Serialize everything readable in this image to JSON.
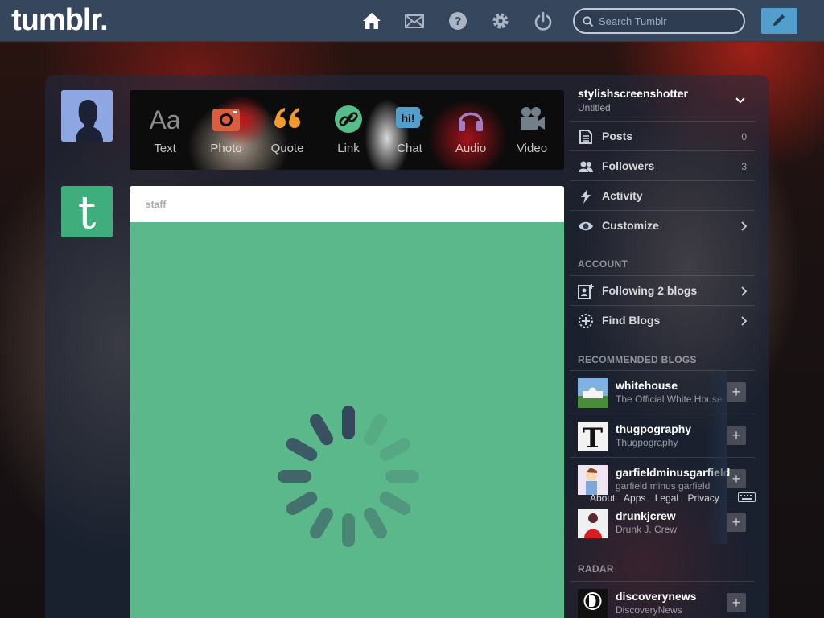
{
  "topbar": {
    "logo": "tumblr.",
    "icons": [
      "home-icon",
      "mail-icon",
      "help-icon",
      "settings-icon",
      "power-icon"
    ],
    "search_placeholder": "Search Tumblr",
    "accent": "#36465d",
    "compose_color": "#529ecc"
  },
  "post_types": [
    {
      "label": "Text",
      "icon": "text-icon",
      "color": "#8c8c8c"
    },
    {
      "label": "Photo",
      "icon": "camera-icon",
      "color": "#d95e40"
    },
    {
      "label": "Quote",
      "icon": "quote-icon",
      "color": "#f2992e"
    },
    {
      "label": "Link",
      "icon": "link-icon",
      "color": "#56bc8a"
    },
    {
      "label": "Chat",
      "icon": "chat-icon",
      "color": "#529ecc"
    },
    {
      "label": "Audio",
      "icon": "headphones-icon",
      "color": "#a77dc2"
    },
    {
      "label": "Video",
      "icon": "video-camera-icon",
      "color": "#748089"
    }
  ],
  "post": {
    "author": "staff",
    "body_color": "#5ab88a"
  },
  "sidebar": {
    "blog_name": "stylishscreenshotter",
    "blog_title": "Untitled",
    "stats": [
      {
        "label": "Posts",
        "count": "0",
        "icon": "posts-icon"
      },
      {
        "label": "Followers",
        "count": "3",
        "icon": "followers-icon"
      },
      {
        "label": "Activity",
        "count": "",
        "icon": "activity-icon"
      },
      {
        "label": "Customize",
        "count": "",
        "icon": "eye-icon"
      }
    ],
    "account_heading": "ACCOUNT",
    "account_items": [
      {
        "label": "Following 2 blogs",
        "icon": "following-icon"
      },
      {
        "label": "Find Blogs",
        "icon": "find-blogs-icon"
      }
    ],
    "recommended_heading": "RECOMMENDED BLOGS",
    "recommended": [
      {
        "name": "whitehouse",
        "title": "The Official White House"
      },
      {
        "name": "thugpography",
        "title": "Thugpography"
      },
      {
        "name": "garfieldminusgarfield",
        "title": "garfield minus garfield"
      },
      {
        "name": "drunkjcrew",
        "title": "Drunk J. Crew"
      }
    ],
    "radar_heading": "RADAR",
    "radar": {
      "name": "discoverynews",
      "title": "DiscoveryNews"
    }
  },
  "footer": {
    "links": [
      "About",
      "Apps",
      "Legal",
      "Privacy"
    ]
  }
}
